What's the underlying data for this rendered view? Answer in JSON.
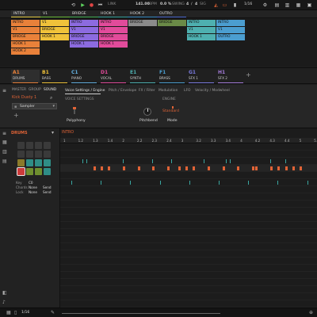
{
  "transport": {
    "tempo": "141.00",
    "tempo_unit": "BPM",
    "swing": "0.0 %",
    "swing_label": "SWING",
    "sig_num": "4",
    "sig_sep": "/",
    "sig_den": "4",
    "sig_label": "SIG",
    "link_label": "LINK",
    "grid": "1/16"
  },
  "scenes": [
    {
      "label": "INTRO",
      "color": "#e8d048"
    },
    {
      "label": "V1",
      "color": "#6fbf3e"
    },
    {
      "label": "BRIDGE",
      "color": "#47b35a"
    },
    {
      "label": "HOOK 1",
      "color": "#3aa5a0"
    },
    {
      "label": "HOOK 2",
      "color": "#3a8fc6"
    },
    {
      "label": "OUTRO",
      "color": "#4d6bd1"
    }
  ],
  "clip_rows": [
    [
      {
        "label": "INTRO",
        "color": "#e9813a"
      },
      {
        "label": "V1",
        "color": "#f0c23a"
      },
      {
        "label": "INTRO",
        "color": "#8c6be0"
      },
      {
        "label": "INTRO",
        "color": "#e24b9b"
      },
      {
        "label": "BRIDGE",
        "color": "#8b8b8b"
      },
      {
        "label": "BRIDGE",
        "color": "#6a8a47"
      },
      {
        "label": "INTRO",
        "color": "#4eb0b0"
      },
      {
        "label": "INTRO",
        "color": "#4b9ed0"
      }
    ],
    [
      {
        "label": "V1",
        "color": "#e9813a"
      },
      {
        "label": "BRIDGE",
        "color": "#f0c23a"
      },
      {
        "label": "V1",
        "color": "#8c6be0"
      },
      {
        "label": "V1",
        "color": "#e24b9b"
      },
      {
        "label": "",
        "color": ""
      },
      {
        "label": "",
        "color": ""
      },
      {
        "label": "V1",
        "color": "#4eb0b0"
      },
      {
        "label": "V1",
        "color": "#4b9ed0"
      }
    ],
    [
      {
        "label": "BRIDGE",
        "color": "#e9813a"
      },
      {
        "label": "HOOK 1",
        "color": "#f0c23a"
      },
      {
        "label": "BRIDGE",
        "color": "#8c6be0"
      },
      {
        "label": "BRIDGE",
        "color": "#e24b9b"
      },
      {
        "label": "",
        "color": ""
      },
      {
        "label": "",
        "color": ""
      },
      {
        "label": "HOOK 1",
        "color": "#4eb0b0"
      },
      {
        "label": "OUTRO",
        "color": "#4b9ed0"
      }
    ],
    [
      {
        "label": "HOOK 1",
        "color": "#e9813a"
      },
      {
        "label": "",
        "color": ""
      },
      {
        "label": "HOOK 1",
        "color": "#8c6be0"
      },
      {
        "label": "HOOK 1",
        "color": "#e24b9b"
      },
      {
        "label": "",
        "color": ""
      },
      {
        "label": "",
        "color": ""
      },
      {
        "label": "",
        "color": ""
      },
      {
        "label": "",
        "color": ""
      }
    ],
    [
      {
        "label": "HOOK 2",
        "color": "#e9813a"
      },
      {
        "label": "",
        "color": ""
      },
      {
        "label": "",
        "color": ""
      },
      {
        "label": "",
        "color": ""
      },
      {
        "label": "",
        "color": ""
      },
      {
        "label": "",
        "color": ""
      },
      {
        "label": "",
        "color": ""
      },
      {
        "label": "",
        "color": ""
      }
    ]
  ],
  "groups": [
    {
      "key": "A1",
      "name": "DRUMS",
      "color": "#e8813a"
    },
    {
      "key": "B1",
      "name": "BASS",
      "color": "#efc23a"
    },
    {
      "key": "C1",
      "name": "PIANO",
      "color": "#64b0e0"
    },
    {
      "key": "D1",
      "name": "VOCAL",
      "color": "#e24b9b"
    },
    {
      "key": "E1",
      "name": "SYNTH",
      "color": "#4eb0b0"
    },
    {
      "key": "F1",
      "name": "BRASS",
      "color": "#4b9ed0"
    },
    {
      "key": "G1",
      "name": "SFX 1",
      "color": "#7b7be0"
    },
    {
      "key": "H1",
      "name": "SFX 2",
      "color": "#a37bd8"
    }
  ],
  "control": {
    "level_tabs": [
      "MASTER",
      "GROUP",
      "SOUND"
    ],
    "sound_name": "Kick Dusty 1",
    "plugin": "Sampler",
    "param_tabs": [
      "Voice Settings / Engine",
      "Pitch / Envelope",
      "FX / Filter",
      "Modulation",
      "LFO",
      "Velocity / Modwheel"
    ],
    "section_voice": "VOICE SETTINGS",
    "section_engine": "ENGINE",
    "polyphony_label": "Polyphony",
    "pitchbend_label": "Pitchbend",
    "mode_value": "Standard",
    "mode_label": "Mode"
  },
  "pattern": {
    "group_name": "DRUMS",
    "pattern_name": "INTRO",
    "ruler": [
      "1",
      "1.2",
      "1.3",
      "1.4",
      "2",
      "2.2",
      "2.3",
      "2.4",
      "3",
      "3.2",
      "3.3",
      "3.4",
      "4",
      "4.2",
      "4.3",
      "4.4",
      "5",
      "5.2"
    ],
    "key_label": "Key",
    "key_value": "C0",
    "chords_label": "Chords",
    "chords_value": "None",
    "chords_extra": "Send",
    "lock_label": "Lock",
    "lock_value": "None",
    "lock_extra": "Send",
    "footer_grid": "1/16"
  }
}
